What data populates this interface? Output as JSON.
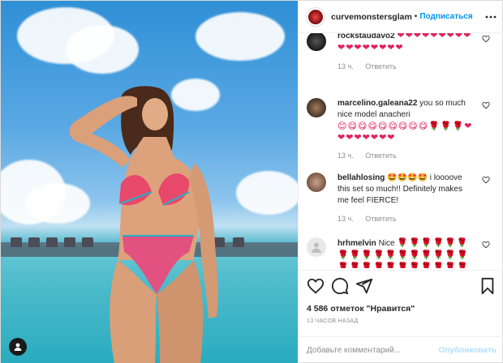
{
  "post": {
    "photo_alt_icon": "user-icon"
  },
  "header": {
    "username": "curvemonstersglam",
    "separator": "•",
    "follow_label": "Подписаться",
    "more_icon": "more-icon"
  },
  "comments": [
    {
      "username": "rockstaudavo2",
      "text": "❤❤❤❤❤❤❤❤❤❤❤❤❤❤❤❤❤",
      "time": "13 ч.",
      "reply": "Ответить"
    },
    {
      "username": "marcelino.galeana22",
      "text": " you so much nice model anacheri",
      "emoji": "😊😋😋😋😋😋😋😋😋🌹🌹🌹❤❤❤❤❤❤❤❤",
      "time": "13 ч.",
      "reply": "Ответить"
    },
    {
      "username": "bellahlosing",
      "text": " 🤩🤩🤩🤩 i loooove this set so much!! Definitely makes me feel FIERCE!",
      "time": "13 ч.",
      "reply": "Ответить"
    },
    {
      "username": "hrhmelvin",
      "text": " Nice",
      "emoji": "🌹🌹🌹🌹🌹🌹🌹🌹🌹🌹🌹🌹🌹🌹🌹🌹🌹🌹🌹🌹🌹🌹🌹🌹🌹🌹🌹🌹🌹🌹🌹🌹",
      "time": "",
      "reply": ""
    }
  ],
  "actions": {
    "like_icon": "heart-icon",
    "comment_icon": "comment-icon",
    "share_icon": "share-icon",
    "save_icon": "bookmark-icon"
  },
  "likes": "4 586 отметок \"Нравится\"",
  "posted": "13 ЧАСОВ НАЗАД",
  "composer": {
    "placeholder": "Добавьте комментарий...",
    "publish_label": "Опубликовать"
  },
  "colors": {
    "link": "#0095f6",
    "publish_disabled": "#b2dffc",
    "muted": "#8e8e8e"
  }
}
